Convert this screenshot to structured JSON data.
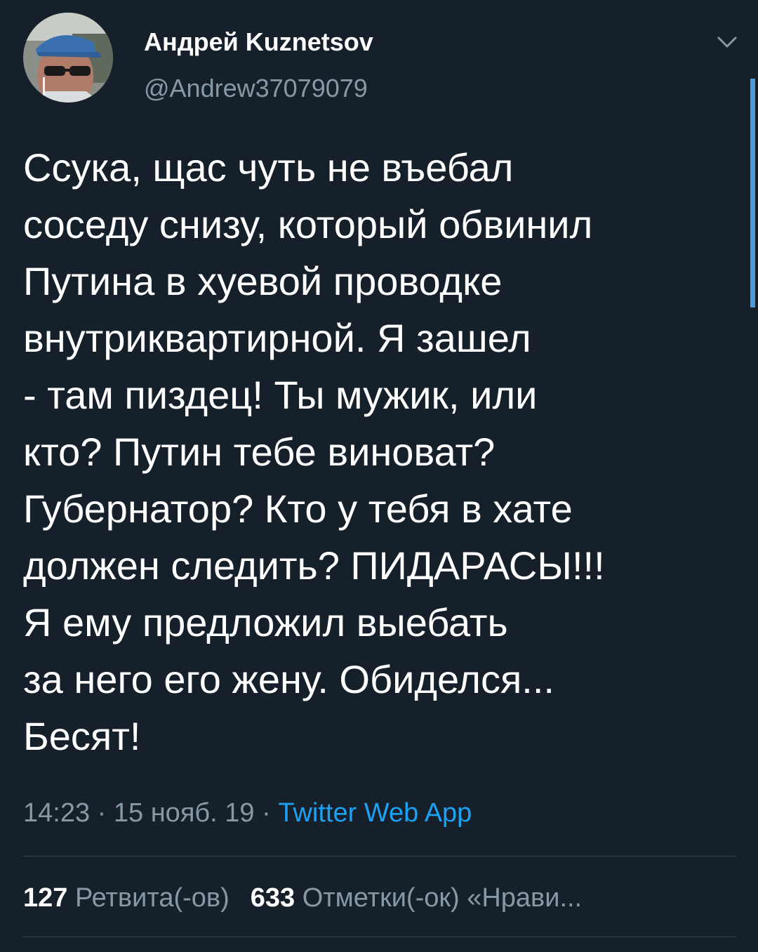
{
  "tweet": {
    "author": {
      "display_name": "Андрей Kuznetsov",
      "handle": "@Andrew37079079"
    },
    "text": "Ссука, щас чуть не въебал\nсоседу снизу, который обвинил\nПутина в хуевой проводке\nвнутриквартирной. Я зашел\n- там пиздец! Ты мужик, или\nкто? Путин тебе виноват?\nГубернатор? Кто у тебя в хате\nдолжен следить? ПИДАРАСЫ!!!\nЯ ему предложил выебать\nза него его жену. Обиделся...\nБесят!",
    "time": "14:23",
    "sep": "·",
    "date": "15 нояб. 19",
    "source": "Twitter Web App",
    "retweets_count": "127",
    "retweets_label": "Ретвита(-ов)",
    "likes_count": "633",
    "likes_label": "Отметки(-ок) «Нрави..."
  },
  "icons": {
    "menu": "chevron-down-icon",
    "avatar": "user-avatar"
  },
  "colors": {
    "background": "#15202b",
    "secondary_text": "#8899a6",
    "accent": "#1da1f2",
    "divider": "#38444d"
  }
}
